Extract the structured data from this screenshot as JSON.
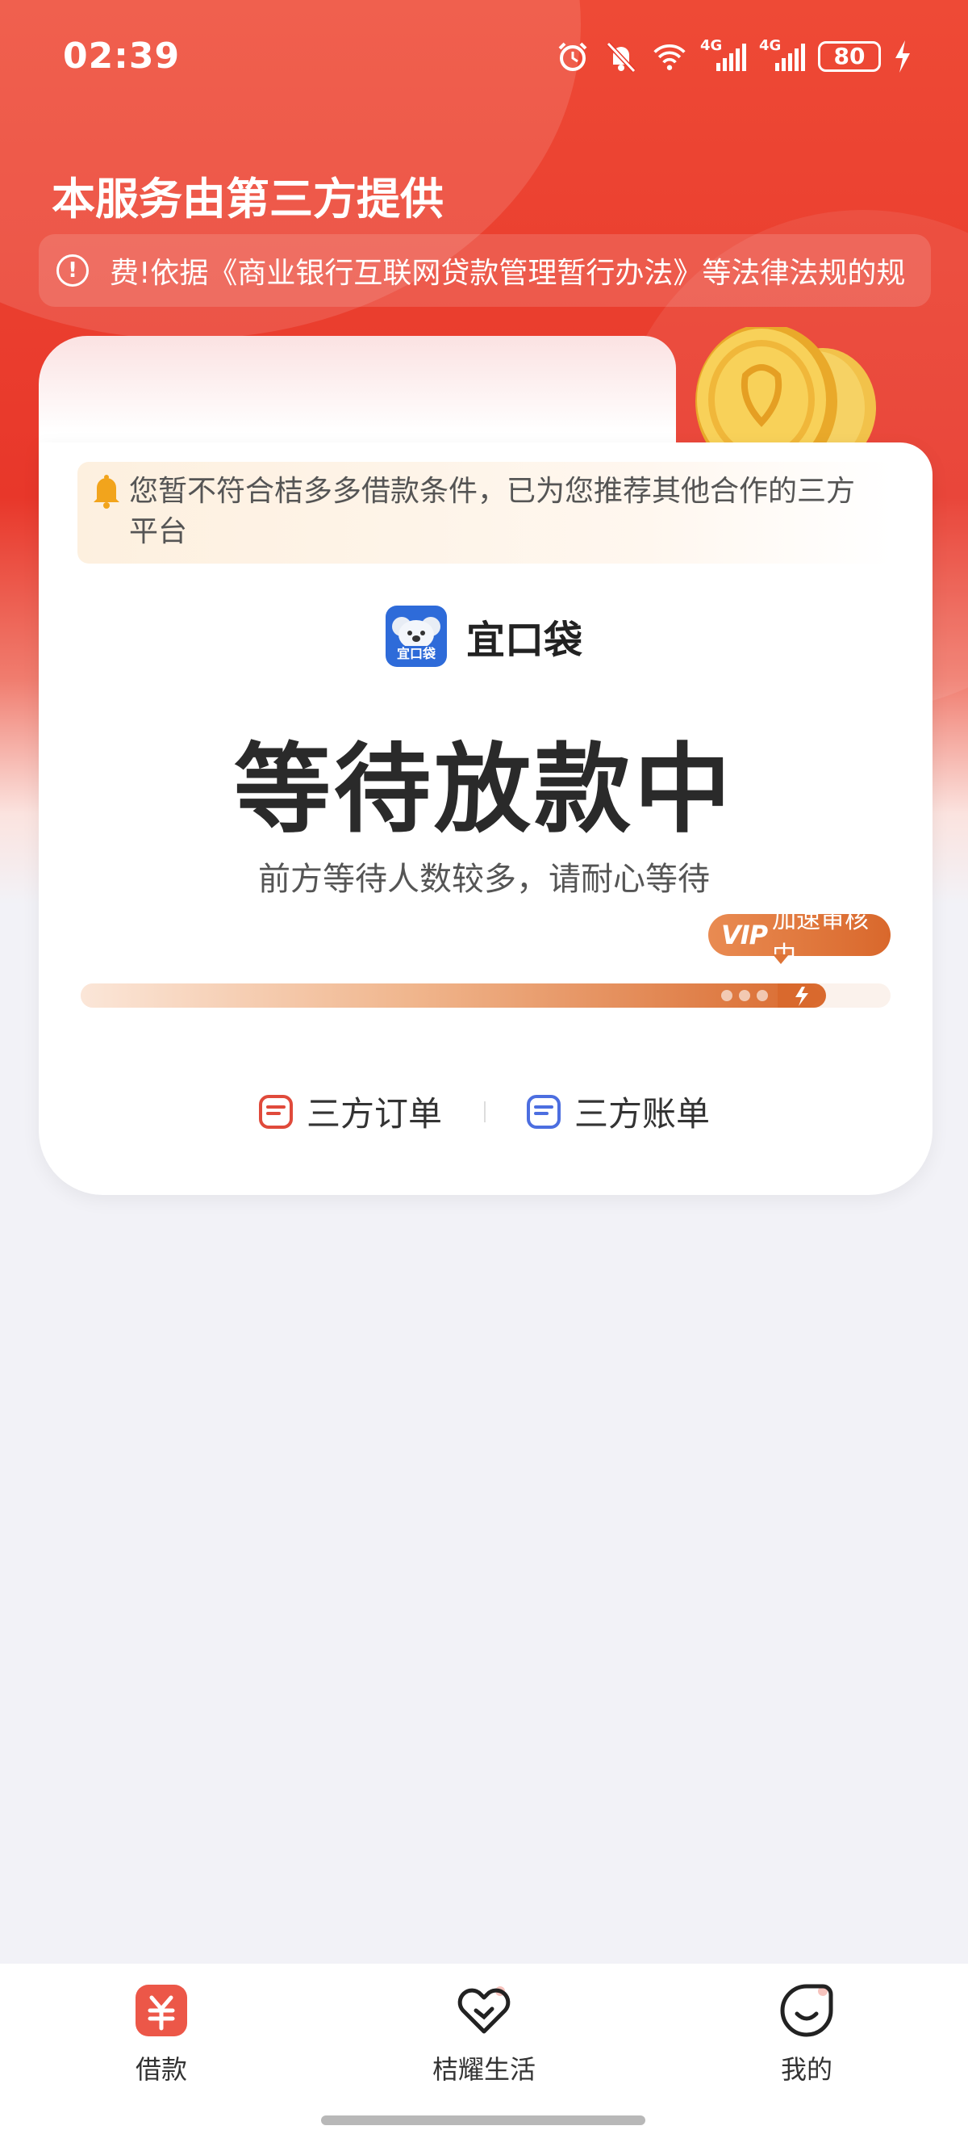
{
  "status_bar": {
    "time": "02:39",
    "signal1_label": "4G",
    "signal2_label": "4G",
    "battery": "80"
  },
  "header": {
    "title": "本服务由第三方提供",
    "notice": "费!依据《商业银行互联网贷款管理暂行办法》等法律法规的规"
  },
  "card": {
    "reject_message": "您暂不符合桔多多借款条件，已为您推荐其他合作的三方平台",
    "partner_name": "宜口袋",
    "partner_logo_text": "宜口袋",
    "status_title": "等待放款中",
    "status_subtitle": "前方等待人数较多，请耐心等待",
    "vip_tag": "VIP",
    "vip_label": "加速审核中",
    "progress_fraction": 0.92,
    "link_orders": "三方订单",
    "link_bills": "三方账单"
  },
  "bottom_nav": {
    "items": [
      {
        "label": "借款",
        "icon": "yuan-icon"
      },
      {
        "label": "桔耀生活",
        "icon": "heart-check-icon"
      },
      {
        "label": "我的",
        "icon": "smile-icon"
      }
    ]
  },
  "colors": {
    "brand_red": "#e8372a",
    "accent_orange": "#d9692d",
    "order_icon_red": "#e04a3b",
    "bill_icon_blue": "#4c6ee0"
  }
}
